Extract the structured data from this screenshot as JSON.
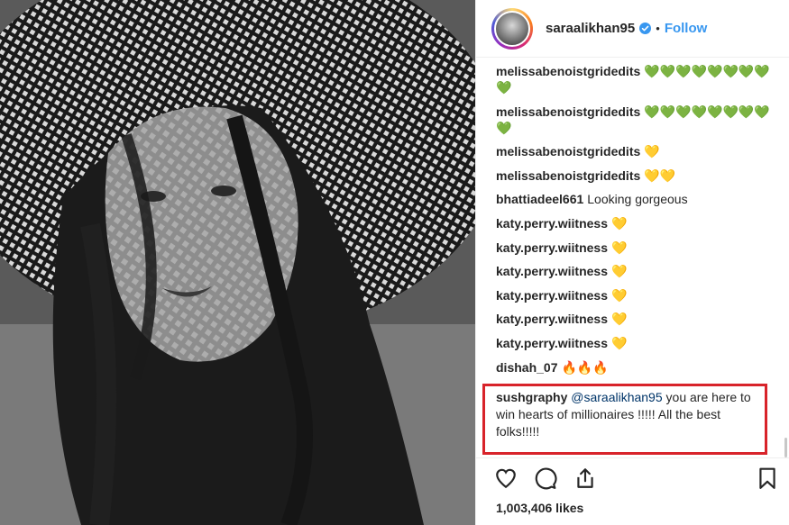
{
  "post": {
    "username": "saraalikhan95",
    "follow_label": "Follow",
    "separator": "•",
    "verified_icon": "verified-badge-icon",
    "photo_alt": "black and white portrait photo with woven straw hat"
  },
  "comments": [
    {
      "author": "melissabenoistgridedits",
      "text": "💚💚💚💚💚💚💚💚💚"
    },
    {
      "author": "melissabenoistgridedits",
      "text": "💚💚💚💚💚💚💚💚💚"
    },
    {
      "author": "melissabenoistgridedits",
      "text": "💛"
    },
    {
      "author": "melissabenoistgridedits",
      "text": "💛💛"
    },
    {
      "author": "bhattiadeel661",
      "text": "Looking gorgeous"
    },
    {
      "author": "katy.perry.wiitness",
      "text": "💛"
    },
    {
      "author": "katy.perry.wiitness",
      "text": "💛"
    },
    {
      "author": "katy.perry.wiitness",
      "text": "💛"
    },
    {
      "author": "katy.perry.wiitness",
      "text": "💛"
    },
    {
      "author": "katy.perry.wiitness",
      "text": "💛"
    },
    {
      "author": "katy.perry.wiitness",
      "text": "💛"
    },
    {
      "author": "dishah_07",
      "text": "🔥🔥🔥"
    }
  ],
  "highlighted_comment": {
    "author": "sushgraphy",
    "mention": "@saraalikhan95",
    "text": "you are here to win hearts of millionaires !!!!! All the best folks!!!!!"
  },
  "actions": {
    "like_icon": "heart-icon",
    "comment_icon": "comment-icon",
    "share_icon": "share-icon",
    "save_icon": "bookmark-icon"
  },
  "likes": "1,003,406 likes",
  "colors": {
    "link_blue": "#3897f0",
    "highlight_red": "#d8232a",
    "text": "#262626"
  }
}
